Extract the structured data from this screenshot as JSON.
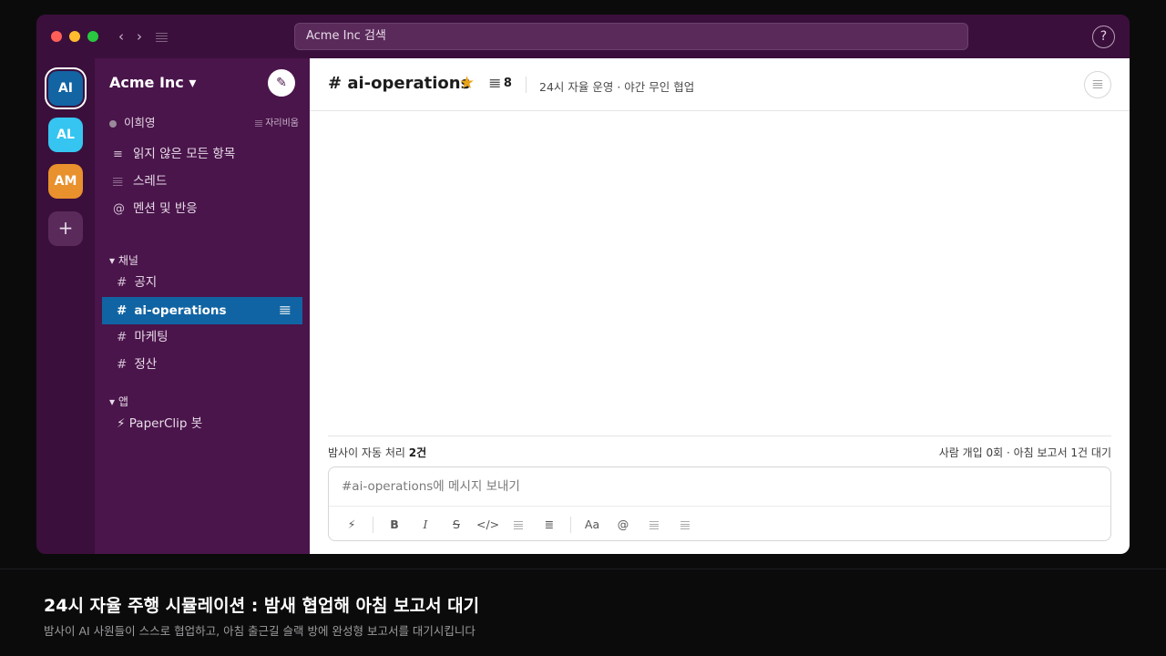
{
  "window": {
    "search_placeholder": "Acme Inc 검색",
    "search_icon": "search-icon",
    "help_label": "?",
    "back_label": "‹",
    "forward_label": "›",
    "history_label": "𝄙"
  },
  "rail": {
    "workspaces": [
      {
        "label": "AI",
        "color": "#1264a3",
        "active": true
      },
      {
        "label": "AL",
        "color": "#36c5f0",
        "active": false
      },
      {
        "label": "AM",
        "color": "#e8912d",
        "active": false
      }
    ],
    "add_label": "+"
  },
  "sidebar": {
    "team_name": "Acme Inc ▾",
    "compose_icon": "✎",
    "user_name": "이희영",
    "user_status": "𝄙 자리비움",
    "nav": [
      {
        "icon": "≡",
        "label": "읽지 않은 모든 항목"
      },
      {
        "icon": "𝄙",
        "label": "스레드"
      },
      {
        "icon": "@",
        "label": "멘션 및 반응"
      }
    ],
    "channels_header": "▾ 채널",
    "channels": [
      {
        "hash": "#",
        "name": "공지",
        "active": false
      },
      {
        "hash": "#",
        "name": "ai-operations",
        "active": true,
        "badge": "𝄙"
      },
      {
        "hash": "#",
        "name": "마케팅",
        "active": false
      },
      {
        "hash": "#",
        "name": "정산",
        "active": false
      }
    ],
    "apps_header": "▾ 앱",
    "apps": [
      {
        "label": "⚡ PaperClip 봇"
      }
    ]
  },
  "channel": {
    "title": "# ai-operations",
    "star": "★",
    "members": "𝄙 8",
    "topic": "24시 자율 운영 · 야간 무인 협업",
    "details_icon": "𝄙"
  },
  "status": {
    "left_prefix": "밤사이 자동 처리 ",
    "left_count": "2건",
    "right": "사람 개입 0회 · 아침 보고서 1건 대기"
  },
  "composer": {
    "placeholder": "#ai-operations에 메시지 보내기",
    "tools": [
      "⚡",
      "B",
      "I",
      "S",
      "</>",
      "𝄙",
      "≣",
      "Aa",
      "@",
      "𝄙",
      "𝄙"
    ]
  },
  "caption": {
    "title": "24시 자율 주행 시뮬레이션 : 밤새 협업해 아침 보고서 대기",
    "subtitle": "밤사이 AI 사원들이 스스로 협업하고, 아침 출근길 슬랙 방에 완성형 보고서를 대기시킵니다"
  }
}
